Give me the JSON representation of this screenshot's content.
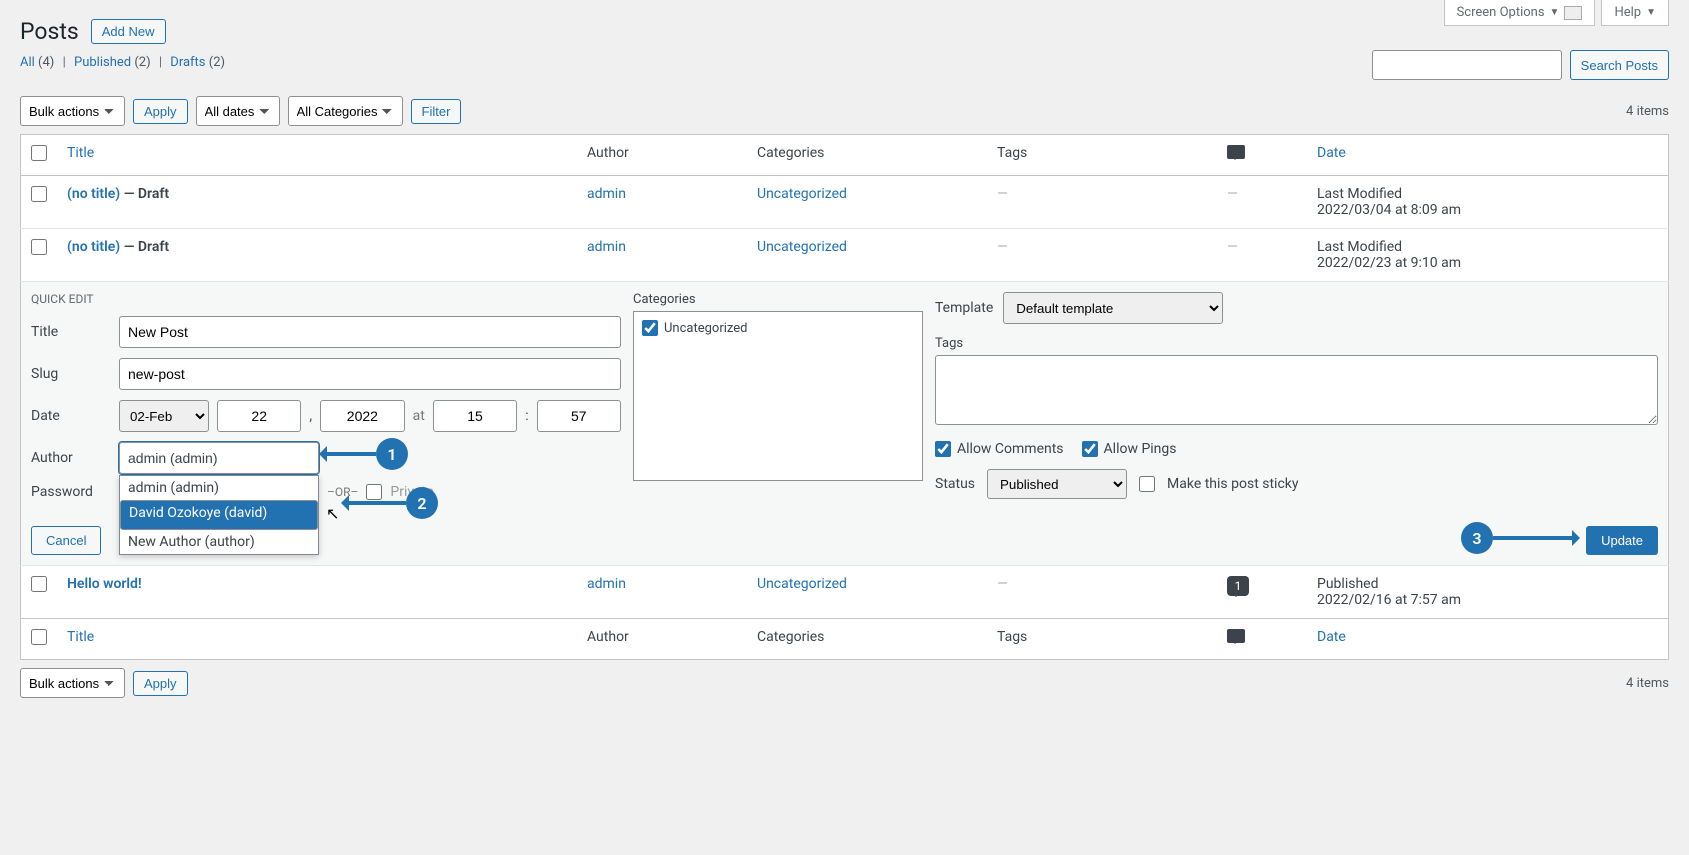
{
  "top": {
    "screen_options": "Screen Options",
    "help": "Help"
  },
  "header": {
    "title": "Posts",
    "add_new": "Add New"
  },
  "filters_links": {
    "all_label": "All",
    "all_count": "(4)",
    "published_label": "Published",
    "published_count": "(2)",
    "drafts_label": "Drafts",
    "drafts_count": "(2)"
  },
  "search": {
    "button": "Search Posts"
  },
  "tablenav": {
    "bulk": "Bulk actions",
    "apply": "Apply",
    "all_dates": "All dates",
    "all_categories": "All Categories",
    "filter": "Filter",
    "items_count": "4 items"
  },
  "columns": {
    "title": "Title",
    "author": "Author",
    "categories": "Categories",
    "tags": "Tags",
    "date": "Date"
  },
  "rows": [
    {
      "title_link": "(no title)",
      "state": " — Draft",
      "author": "admin",
      "category": "Uncategorized",
      "tags": "—",
      "comments": "—",
      "date_label": "Last Modified",
      "date_value": "2022/03/04 at 8:09 am"
    },
    {
      "title_link": "(no title)",
      "state": " — Draft",
      "author": "admin",
      "category": "Uncategorized",
      "tags": "—",
      "comments": "—",
      "date_label": "Last Modified",
      "date_value": "2022/02/23 at 9:10 am"
    }
  ],
  "quick_edit": {
    "heading": "QUICK EDIT",
    "labels": {
      "title": "Title",
      "slug": "Slug",
      "date": "Date",
      "author": "Author",
      "password": "Password",
      "categories": "Categories",
      "template": "Template",
      "tags": "Tags",
      "status": "Status"
    },
    "values": {
      "title": "New Post",
      "slug": "new-post",
      "month": "02-Feb",
      "day": "22",
      "year": "2022",
      "hour": "15",
      "minute": "57",
      "at": "at",
      "author_input": "admin (admin)",
      "or": "–OR–",
      "private": "Private",
      "template": "Default template",
      "cat_uncategorized": "Uncategorized",
      "allow_comments": "Allow Comments",
      "allow_pings": "Allow Pings",
      "status": "Published",
      "sticky": "Make this post sticky"
    },
    "author_options": [
      "admin (admin)",
      "David Ozokoye (david)",
      "New Author (author)"
    ],
    "buttons": {
      "cancel": "Cancel",
      "update": "Update"
    }
  },
  "row_hello": {
    "title": "Hello world!",
    "author": "admin",
    "category": "Uncategorized",
    "tags": "—",
    "comments": "1",
    "date_label": "Published",
    "date_value": "2022/02/16 at 7:57 am"
  },
  "annotations": {
    "b1": "1",
    "b2": "2",
    "b3": "3"
  }
}
